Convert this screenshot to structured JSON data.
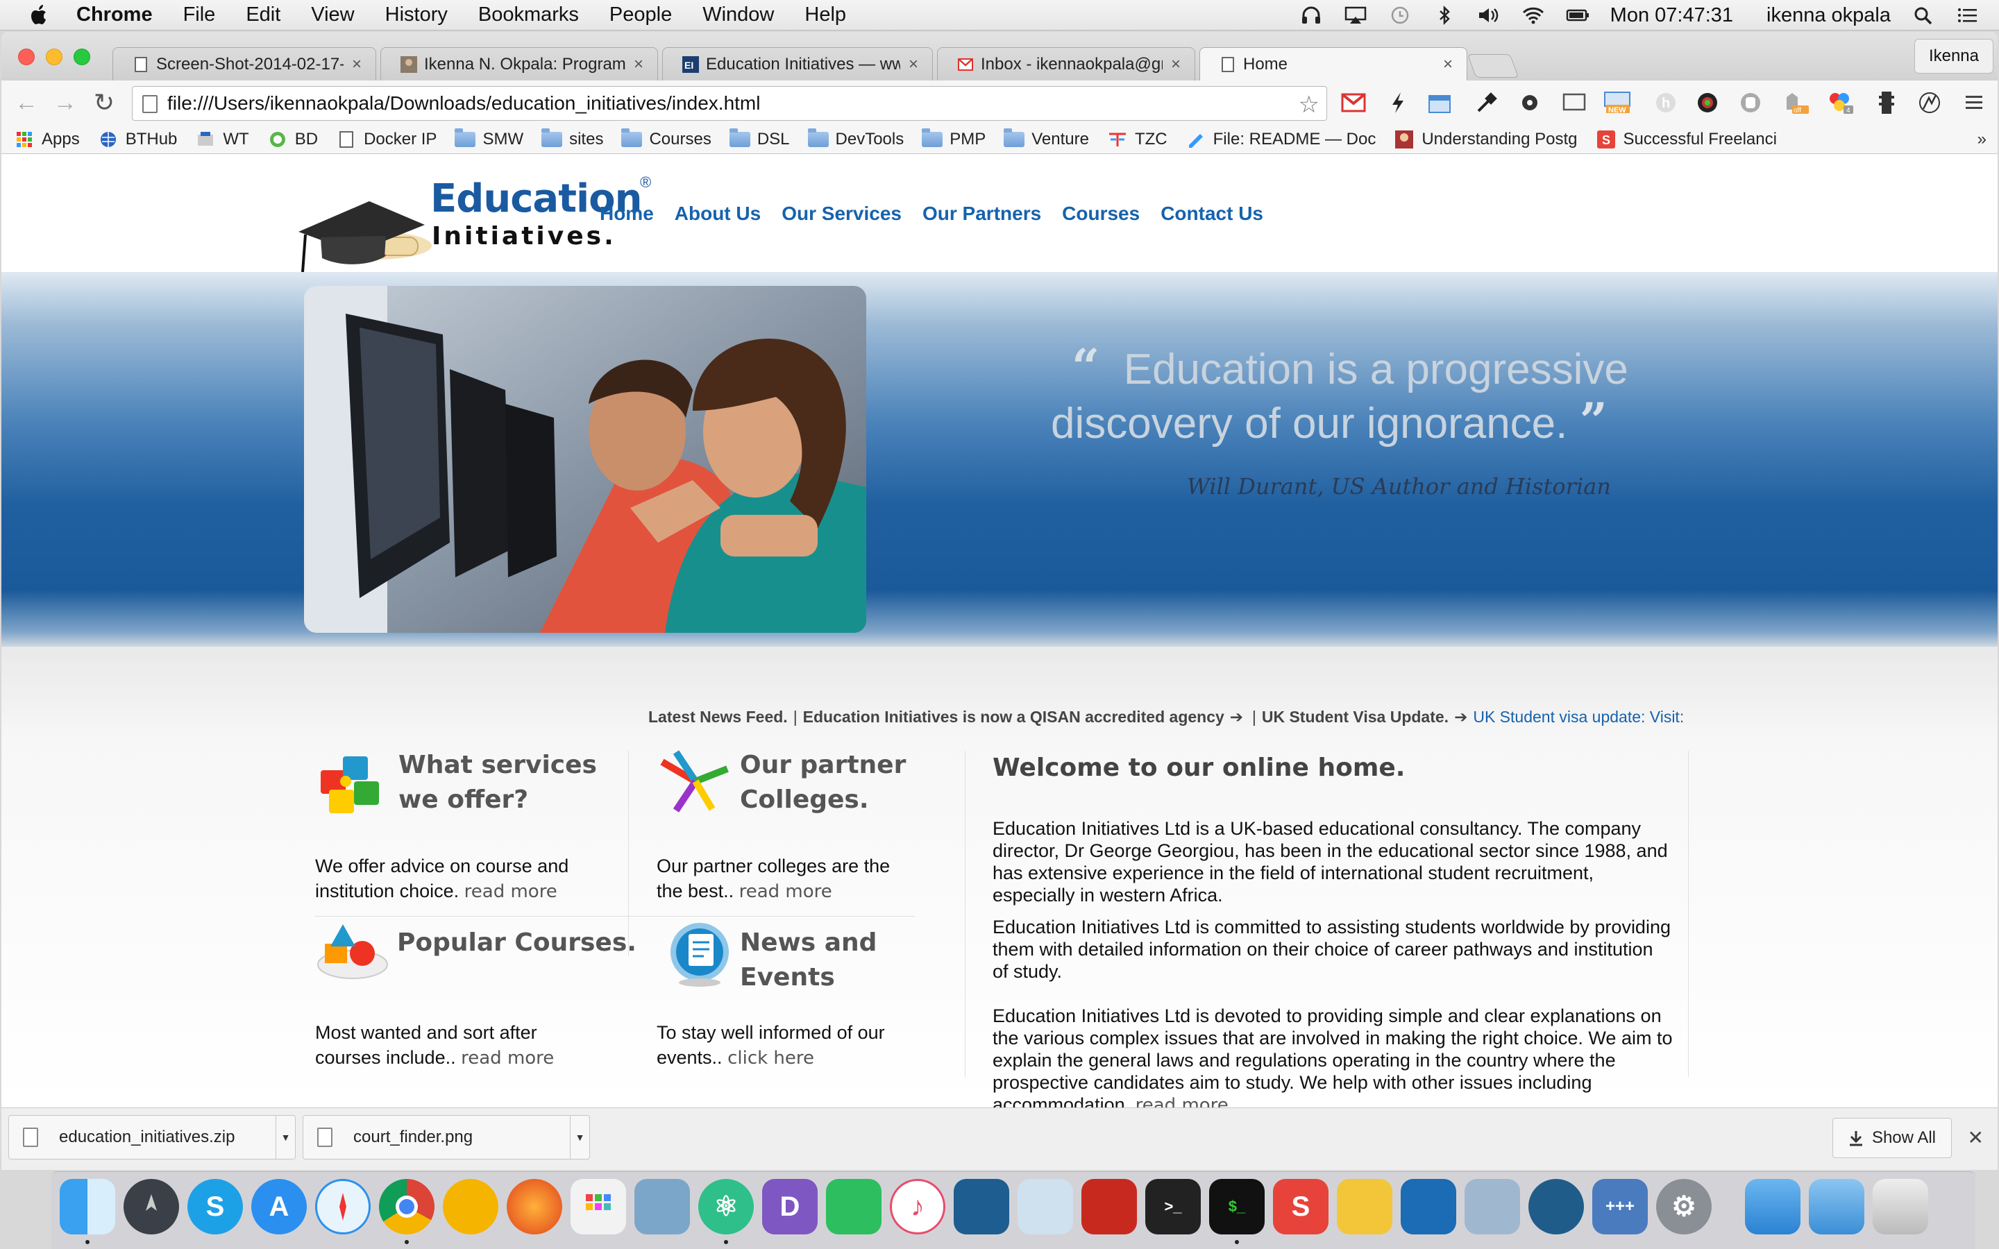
{
  "menubar": {
    "app_name": "Chrome",
    "menus": [
      "File",
      "Edit",
      "View",
      "History",
      "Bookmarks",
      "People",
      "Window",
      "Help"
    ],
    "clock": "Mon 07:47:31",
    "user": "ikenna okpala"
  },
  "browser": {
    "tabs": [
      {
        "label": "Screen-Shot-2014-02-17-",
        "active": false
      },
      {
        "label": "Ikenna N. Okpala: Program",
        "active": false
      },
      {
        "label": "Education Initiatives — www",
        "active": false
      },
      {
        "label": "Inbox - ikennaokpala@gmai",
        "active": false
      },
      {
        "label": "Home",
        "active": true
      }
    ],
    "profile_name": "Ikenna",
    "url": "file:///Users/ikennaokpala/Downloads/education_initiatives/index.html",
    "bookmarks": [
      {
        "label": "Apps",
        "icon": "apps-grid-icon"
      },
      {
        "label": "BTHub",
        "icon": "globe-icon"
      },
      {
        "label": "WT",
        "icon": "wt-icon"
      },
      {
        "label": "BD",
        "icon": "circle-icon"
      },
      {
        "label": "Docker IP",
        "icon": "page-icon"
      },
      {
        "label": "SMW",
        "icon": "folder-icon"
      },
      {
        "label": "sites",
        "icon": "folder-icon"
      },
      {
        "label": "Courses",
        "icon": "folder-icon"
      },
      {
        "label": "DSL",
        "icon": "folder-icon"
      },
      {
        "label": "DevTools",
        "icon": "folder-icon"
      },
      {
        "label": "PMP",
        "icon": "folder-icon"
      },
      {
        "label": "Venture",
        "icon": "folder-icon"
      },
      {
        "label": "TZC",
        "icon": "tzc-icon"
      },
      {
        "label": "File: README — Doc",
        "icon": "pen-icon"
      },
      {
        "label": "Understanding Postg",
        "icon": "person-icon"
      },
      {
        "label": "Successful Freelanci",
        "icon": "s-logo-icon"
      }
    ]
  },
  "site": {
    "logo": {
      "line1": "Education",
      "line2": "Initiatives.",
      "reg": "®"
    },
    "nav": [
      "Home",
      "About Us",
      "Our Services",
      "Our Partners",
      "Courses",
      "Contact Us"
    ],
    "hero": {
      "quote_open": "“",
      "quote_text_1": "Education is a progressive",
      "quote_text_2": "discovery of our ignorance.",
      "quote_close": "”",
      "author": "Will Durant, US Author and Historian"
    },
    "ticker": {
      "label": "Latest News Feed.",
      "item1": "Education Initiatives is now a QISAN accredited agency",
      "item2": "UK Student Visa Update.",
      "link": "UK Student visa update: Visit:"
    },
    "boxes": {
      "services": {
        "title_1": "What services",
        "title_2": "we offer?",
        "text": "We offer advice on course and institution choice.",
        "more": "read more"
      },
      "partners": {
        "title_1": "Our partner",
        "title_2": "Colleges.",
        "text": "Our partner colleges are the the best..",
        "more": "read more"
      },
      "courses": {
        "title_1": "Popular Courses.",
        "text": "Most wanted and sort after courses include..",
        "more": "read more"
      },
      "news": {
        "title_1": "News and",
        "title_2": "Events",
        "text": "To stay well informed of our events..",
        "more": "click here"
      }
    },
    "welcome": {
      "title": "Welcome to our online home.",
      "p1": "Education Initiatives Ltd is a UK-based educational consultancy. The company director, Dr George Georgiou, has been in the educational sector since 1988, and has extensive experience in the field of international student recruitment, especially in western Africa.",
      "p2": "Education Initiatives Ltd is committed to assisting students worldwide by providing them with detailed information on their choice of career pathways and institution of study.",
      "p3": "Education Initiatives Ltd is devoted to providing simple and clear explanations on the various complex issues that are involved in making the right choice. We aim to explain the general laws and regulations operating in the country where the prospective candidates aim to study. We help with other issues including accommodation.",
      "more": "read more"
    }
  },
  "downloads": {
    "items": [
      "education_initiatives.zip",
      "court_finder.png"
    ],
    "show_all": "Show All"
  },
  "colors": {
    "nav_link": "#1662ad",
    "hero_blue": "#1b5a9a",
    "logo_blue": "#1a5aa0"
  }
}
